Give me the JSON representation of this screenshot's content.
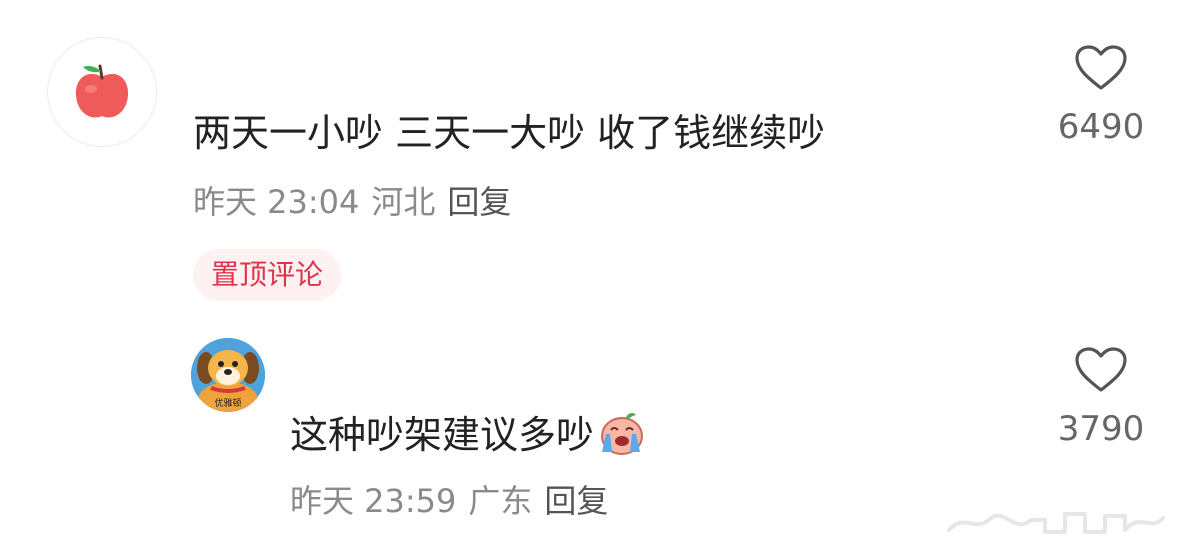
{
  "comments": [
    {
      "avatar_icon": "apple-icon",
      "text": "两天一小吵 三天一大吵 收了钱继续吵",
      "time": "昨天 23:04",
      "location": "河北",
      "reply_label": "回复",
      "pinned_label": "置顶评论",
      "like_icon": "heart-icon",
      "likes": "6490"
    },
    {
      "avatar_icon": "dog-icon",
      "avatar_caption": "优雅顿",
      "text": "这种吵架建议多吵",
      "emoji_icon": "crying-emoji-icon",
      "time": "昨天 23:59",
      "location": "广东",
      "reply_label": "回复",
      "like_icon": "heart-icon",
      "likes": "3790"
    }
  ],
  "colors": {
    "pinned_text": "#e0334b",
    "pinned_bg": "#fdf1f1",
    "meta": "#8a8a8a"
  }
}
